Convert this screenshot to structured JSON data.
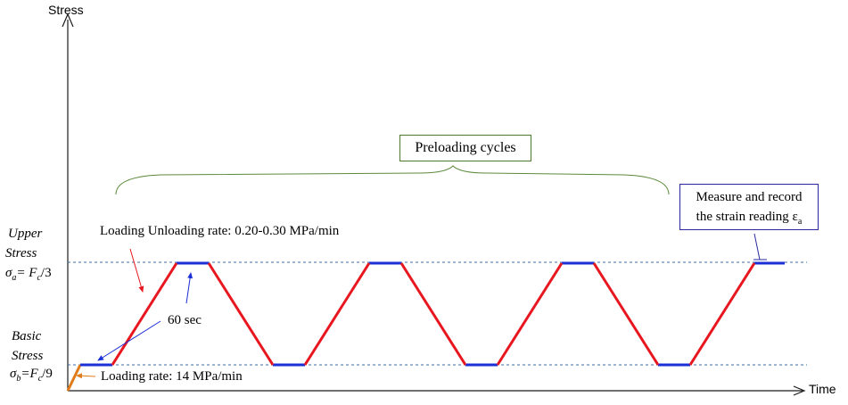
{
  "axes": {
    "y_label": "Stress",
    "x_label": "Time"
  },
  "levels": {
    "upper_line1": "Upper",
    "upper_line2": "Stress",
    "upper_formula_sigma": "σ",
    "upper_formula_sub": "a",
    "upper_formula_eq": "= F",
    "upper_formula_csub": "c",
    "upper_formula_tail": "/3",
    "basic_line1": "Basic",
    "basic_line2": "Stress",
    "basic_formula_sigma": "σ",
    "basic_formula_sub": "b",
    "basic_formula_eq": "=F",
    "basic_formula_csub": "c",
    "basic_formula_tail": "/9"
  },
  "annotations": {
    "preloading_cycles": "Preloading cycles",
    "loading_unloading_rate": "Loading Unloading rate: 0.20-0.30 MPa/min",
    "hold_time": "60 sec",
    "loading_rate": "Loading rate: 14 MPa/min",
    "measure_line1": "Measure and record",
    "measure_line2_prefix": "the strain reading ε",
    "measure_line2_sub": "a"
  },
  "colors": {
    "ramp": "#e8171f",
    "hold": "#1a2fd6",
    "initial_ramp": "#e07b1a",
    "axis": "#1a1a1a",
    "reference_line": "#3e6ea8",
    "brace": "#5b8a3a",
    "preload_box_border": "#4e7a2e",
    "measure_box_border": "#2a2aa0",
    "red_arrow": "#e8171f",
    "blue_arrow": "#1a2fd6"
  }
}
